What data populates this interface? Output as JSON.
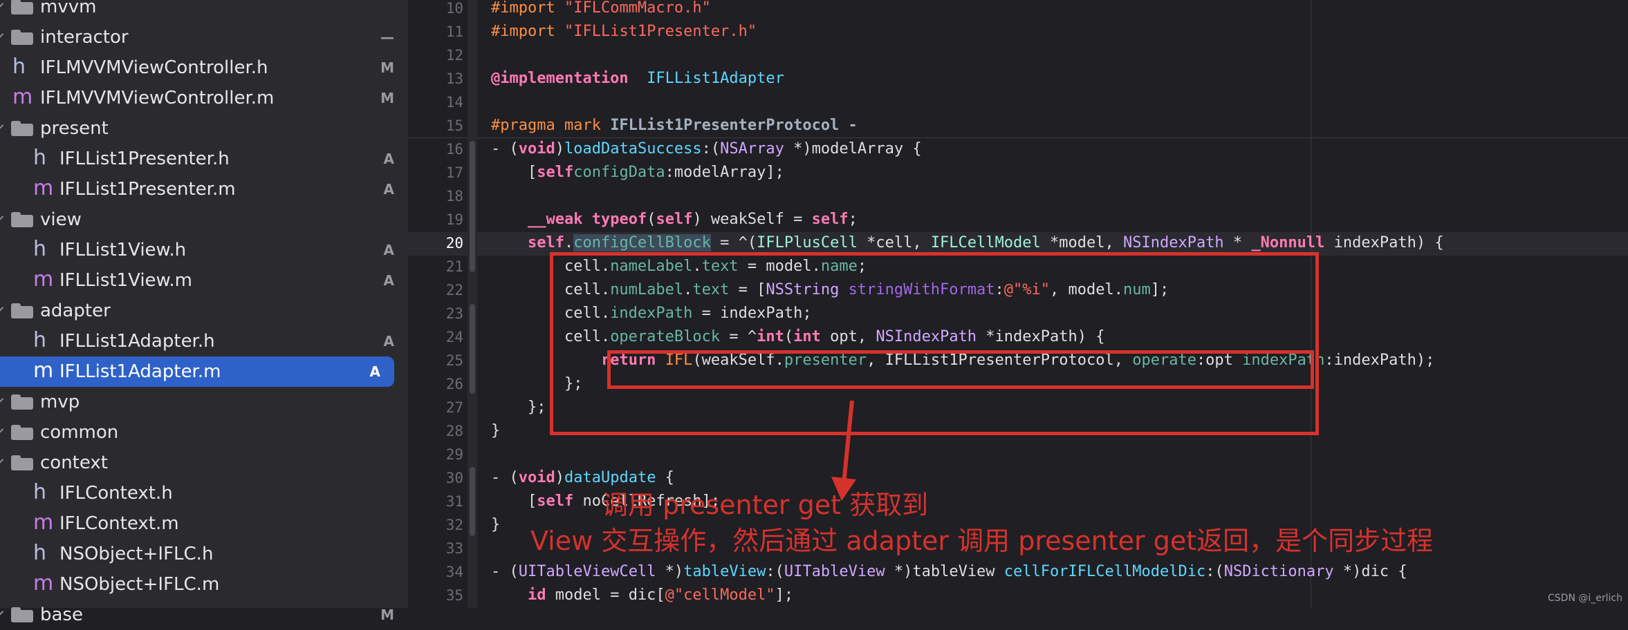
{
  "sidebar": {
    "items": [
      {
        "type": "folder",
        "label": "mvvm",
        "badge": "",
        "indent": 0,
        "chevron": true
      },
      {
        "type": "folder",
        "label": "interactor",
        "badge": "—",
        "indent": 1,
        "chevron": true
      },
      {
        "type": "h",
        "label": "IFLMVVMViewController.h",
        "badge": "M",
        "indent": 1
      },
      {
        "type": "m",
        "label": "IFLMVVMViewController.m",
        "badge": "M",
        "indent": 1
      },
      {
        "type": "folder",
        "label": "present",
        "badge": "",
        "indent": 1,
        "chevron": true
      },
      {
        "type": "h",
        "label": "IFLList1Presenter.h",
        "badge": "A",
        "indent": 2
      },
      {
        "type": "m",
        "label": "IFLList1Presenter.m",
        "badge": "A",
        "indent": 2
      },
      {
        "type": "folder",
        "label": "view",
        "badge": "",
        "indent": 1,
        "chevron": true
      },
      {
        "type": "h",
        "label": "IFLList1View.h",
        "badge": "A",
        "indent": 2
      },
      {
        "type": "m",
        "label": "IFLList1View.m",
        "badge": "A",
        "indent": 2
      },
      {
        "type": "folder",
        "label": "adapter",
        "badge": "",
        "indent": 1,
        "chevron": true
      },
      {
        "type": "h",
        "label": "IFLList1Adapter.h",
        "badge": "A",
        "indent": 2
      },
      {
        "type": "m",
        "label": "IFLList1Adapter.m",
        "badge": "A",
        "indent": 2,
        "selected": true
      },
      {
        "type": "folder",
        "label": "mvp",
        "badge": "",
        "indent": 0,
        "chevron": true
      },
      {
        "type": "folder",
        "label": "common",
        "badge": "",
        "indent": 1,
        "chevron": true
      },
      {
        "type": "folder",
        "label": "context",
        "badge": "",
        "indent": 1,
        "chevron": true
      },
      {
        "type": "h",
        "label": "IFLContext.h",
        "badge": "",
        "indent": 2
      },
      {
        "type": "m",
        "label": "IFLContext.m",
        "badge": "",
        "indent": 2
      },
      {
        "type": "h",
        "label": "NSObject+IFLC.h",
        "badge": "",
        "indent": 2
      },
      {
        "type": "m",
        "label": "NSObject+IFLC.m",
        "badge": "",
        "indent": 2
      },
      {
        "type": "folder",
        "label": "base",
        "badge": "M",
        "indent": 1,
        "chevron": true
      }
    ]
  },
  "editor": {
    "line_numbers": [
      "10",
      "11",
      "12",
      "13",
      "14",
      "15",
      "16",
      "17",
      "18",
      "19",
      "20",
      "21",
      "22",
      "23",
      "24",
      "25",
      "26",
      "27",
      "28",
      "29",
      "30",
      "31",
      "32",
      "33",
      "34",
      "35"
    ],
    "current_line": "20",
    "lines": [
      [
        [
          "pp",
          "#import "
        ],
        [
          "str",
          "\"IFLCommMacro.h\""
        ]
      ],
      [
        [
          "pp",
          "#import "
        ],
        [
          "str",
          "\"IFLList1Presenter.h\""
        ]
      ],
      [],
      [
        [
          "kw",
          "@implementation"
        ],
        [
          "",
          "  "
        ],
        [
          "ty",
          "IFLList1Adapter"
        ]
      ],
      [],
      [
        [
          "pp",
          "#pragma mark "
        ],
        [
          "mark",
          "IFLList1PresenterProtocol -"
        ]
      ],
      [
        [
          "",
          "- ("
        ],
        [
          "kw",
          "void"
        ],
        [
          "",
          ")"
        ],
        [
          "ty",
          "loadDataSuccess"
        ],
        [
          "",
          ":("
        ],
        [
          "ty2",
          "NSArray"
        ],
        [
          "",
          " *)modelArray {"
        ]
      ],
      [
        [
          "",
          "    ["
        ],
        [
          "kw",
          "self"
        ],
        [
          "",
          "",
          " "
        ],
        [
          "meth",
          "configData"
        ],
        [
          "",
          ":modelArray];"
        ]
      ],
      [],
      [
        [
          "",
          "    "
        ],
        [
          "kw",
          "__weak"
        ],
        [
          "",
          " "
        ],
        [
          "kw",
          "typeof"
        ],
        [
          "",
          "("
        ],
        [
          "kw",
          "self"
        ],
        [
          "",
          ") weakSelf = "
        ],
        [
          "kw",
          "self"
        ],
        [
          "",
          ";"
        ]
      ],
      [
        [
          "",
          "    "
        ],
        [
          "kw",
          "self"
        ],
        [
          "",
          "."
        ],
        [
          "prop sel",
          "configCellBlock"
        ],
        [
          "",
          " = ^("
        ],
        [
          "cls",
          "IFLPlusCell"
        ],
        [
          "",
          " *cell, "
        ],
        [
          "cls",
          "IFLCellModel"
        ],
        [
          "",
          " *model, "
        ],
        [
          "ty2",
          "NSIndexPath"
        ],
        [
          "",
          " * "
        ],
        [
          "nul",
          "_Nonnull"
        ],
        [
          "",
          " indexPath) {"
        ]
      ],
      [
        [
          "",
          "        cell."
        ],
        [
          "prop",
          "nameLabel"
        ],
        [
          "",
          "."
        ],
        [
          "prop",
          "text"
        ],
        [
          "",
          " = model."
        ],
        [
          "prop",
          "name"
        ],
        [
          "",
          ";"
        ]
      ],
      [
        [
          "",
          "        cell."
        ],
        [
          "prop",
          "numLabel"
        ],
        [
          "",
          "."
        ],
        [
          "prop",
          "text"
        ],
        [
          "",
          " = ["
        ],
        [
          "ty2",
          "NSString"
        ],
        [
          "",
          " "
        ],
        [
          "ntype",
          "stringWithFormat"
        ],
        [
          "",
          ":"
        ],
        [
          "str",
          "@\"%i\""
        ],
        [
          "",
          ", model."
        ],
        [
          "prop",
          "num"
        ],
        [
          "",
          "];"
        ]
      ],
      [
        [
          "",
          "        cell."
        ],
        [
          "prop",
          "indexPath"
        ],
        [
          "",
          " = indexPath;"
        ]
      ],
      [
        [
          "",
          "        cell."
        ],
        [
          "prop",
          "operateBlock"
        ],
        [
          "",
          " = ^"
        ],
        [
          "kw",
          "int"
        ],
        [
          "",
          "("
        ],
        [
          "kw",
          "int"
        ],
        [
          "",
          " opt, "
        ],
        [
          "ty2",
          "NSIndexPath"
        ],
        [
          "",
          " *indexPath) {"
        ]
      ],
      [
        [
          "",
          "            "
        ],
        [
          "kw",
          "return"
        ],
        [
          "",
          " "
        ],
        [
          "pp",
          "IFL"
        ],
        [
          "",
          "(weakSelf."
        ],
        [
          "prop",
          "presenter"
        ],
        [
          "",
          ", IFLList1PresenterProtocol, "
        ],
        [
          "meth",
          "operate"
        ],
        [
          "",
          ":opt "
        ],
        [
          "meth",
          "indexPath"
        ],
        [
          "",
          ":indexPath);"
        ]
      ],
      [
        [
          "",
          "        };"
        ]
      ],
      [
        [
          "",
          "    };"
        ]
      ],
      [
        [
          "",
          "}"
        ]
      ],
      [],
      [
        [
          "",
          "- ("
        ],
        [
          "kw",
          "void"
        ],
        [
          "",
          ")"
        ],
        [
          "ty",
          "dataUpdate"
        ],
        [
          "",
          " {"
        ]
      ],
      [
        [
          "",
          "    ["
        ],
        [
          "kw",
          "self"
        ],
        [
          "",
          " noCellRefresh];"
        ]
      ],
      [
        [
          "",
          "}"
        ]
      ],
      [],
      [
        [
          "",
          "- ("
        ],
        [
          "ty2",
          "UITableViewCell"
        ],
        [
          "",
          " *)"
        ],
        [
          "ty",
          "tableView"
        ],
        [
          "",
          ":("
        ],
        [
          "ty2",
          "UITableView"
        ],
        [
          "",
          " *)tableView "
        ],
        [
          "ty",
          "cellForIFLCellModelDic"
        ],
        [
          "",
          ":("
        ],
        [
          "ty2",
          "NSDictionary"
        ],
        [
          "",
          " *)dic {"
        ]
      ],
      [
        [
          "",
          "    "
        ],
        [
          "kw",
          "id"
        ],
        [
          "",
          " model = dic["
        ],
        [
          "str",
          "@\"cellModel\""
        ],
        [
          "",
          "];"
        ]
      ]
    ]
  },
  "annotations": {
    "line1": "调用 presenter get 获取到",
    "line2": "View 交互操作，然后通过 adapter 调用 presenter get返回，是个同步过程",
    "color": "#d6322c"
  },
  "watermark": "CSDN @i_erlich"
}
